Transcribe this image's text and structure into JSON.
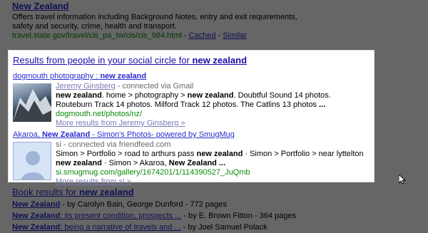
{
  "top_result": {
    "title": "New Zealand",
    "snippet": "Offers travel information including Background Notes, entry and exit requirements, safety and security, crime, health and transport.",
    "url": "travel.state.gov/travel/cis_pa_tw/cis/cis_984.html",
    "separator1": " - ",
    "cached": "Cached",
    "separator2": " - ",
    "similar": "Similar"
  },
  "social": {
    "heading_prefix": "Results from people in your social circle for ",
    "heading_query": "new zealand",
    "items": [
      {
        "title_prefix": "dogmouth photography : ",
        "title_query": "new zealand",
        "person": "Jeremy Ginsberg",
        "connection": " - connected via Gmail",
        "snippet_parts": [
          {
            "text": "new zealand",
            "bold": true
          },
          {
            "text": ". home > photography > ",
            "bold": false
          },
          {
            "text": "new zealand",
            "bold": true
          },
          {
            "text": ". Doubtful Sound 14 photos. Routeburn Track 14 photos. Milford Track 12 photos. The Catlins 13 photos ",
            "bold": false
          },
          {
            "text": "...",
            "bold": true
          }
        ],
        "url": "dogmouth.net/photos/nz/",
        "more": "More results from Jeremy Ginsberg »",
        "thumb_icon": "mountain-photo"
      },
      {
        "title_prefix": "Akaroa, ",
        "title_query": "New Zealand",
        "title_suffix": " - Simon's Photos- powered by SmugMug",
        "person": "si",
        "connection": " - connected via friendfeed.com",
        "snippet_parts": [
          {
            "text": "Simon > Portfolio > road to arthurs pass ",
            "bold": false
          },
          {
            "text": "new zealand",
            "bold": true
          },
          {
            "text": " · Simon > Portfolio > near lyttelton ",
            "bold": false
          },
          {
            "text": "new zealand",
            "bold": true
          },
          {
            "text": " · Simon > Akaroa, ",
            "bold": false
          },
          {
            "text": "New Zealand",
            "bold": true
          },
          {
            "text": " ...",
            "bold": true
          }
        ],
        "url": "si.smugmug.com/gallery/1674201/1/114390527_JuQmb",
        "more": "More results from si »",
        "thumb_icon": "default-avatar"
      }
    ]
  },
  "books": {
    "heading_prefix": "Book results for ",
    "heading_query": "new zealand",
    "lines": [
      {
        "title_query": "New Zealand",
        "title_rest": "",
        "meta": " - by Carolyn Bain, George Dunford - 772 pages"
      },
      {
        "title_query": "New Zealand",
        "title_rest": ": its present condition, prospects ...",
        "meta": " - by E. Brown Fitton - 364 pages"
      },
      {
        "title_query": "New Zealand",
        "title_rest": ": being a narrative of travels and ...",
        "meta": " - by Joel Samuel Polack"
      }
    ]
  },
  "colors": {
    "link": "#2a2ccc",
    "url": "#0a8a0a",
    "overlay": "rgba(0,0,0,0.6)"
  }
}
